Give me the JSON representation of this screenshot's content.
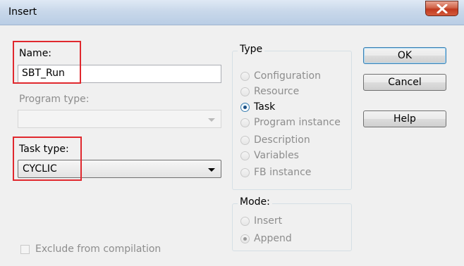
{
  "window": {
    "title": "Insert"
  },
  "fields": {
    "name_label": "Name:",
    "name_value": "SBT_Run",
    "program_type_label": "Program type:",
    "program_type_value": "",
    "task_type_label": "Task type:",
    "task_type_value": "CYCLIC",
    "exclude_label": "Exclude from compilation"
  },
  "type_group": {
    "label": "Type",
    "options": [
      {
        "label": "Configuration",
        "selected": false,
        "enabled": false
      },
      {
        "label": "Resource",
        "selected": false,
        "enabled": false
      },
      {
        "label": "Task",
        "selected": true,
        "enabled": true
      },
      {
        "label": "Program instance",
        "selected": false,
        "enabled": false
      },
      {
        "label": "Description",
        "selected": false,
        "enabled": false
      },
      {
        "label": "Variables",
        "selected": false,
        "enabled": false
      },
      {
        "label": "FB instance",
        "selected": false,
        "enabled": false
      }
    ]
  },
  "mode_group": {
    "label": "Mode:",
    "options": [
      {
        "label": "Insert",
        "selected": false,
        "enabled": false
      },
      {
        "label": "Append",
        "selected": true,
        "enabled": false
      }
    ]
  },
  "buttons": {
    "ok": "OK",
    "cancel": "Cancel",
    "help": "Help"
  },
  "colors": {
    "highlight": "#e0282e",
    "close_button": "#c0391f"
  }
}
